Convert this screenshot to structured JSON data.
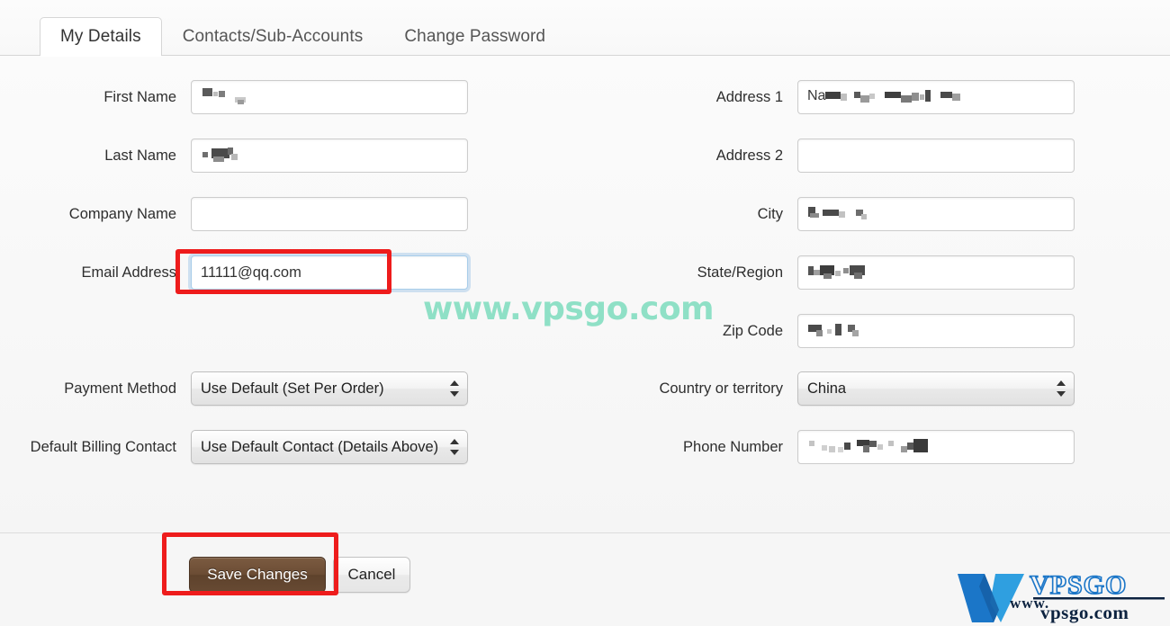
{
  "tabs": [
    {
      "label": "My Details",
      "active": true
    },
    {
      "label": "Contacts/Sub-Accounts",
      "active": false
    },
    {
      "label": "Change Password",
      "active": false
    }
  ],
  "form": {
    "left": [
      {
        "label": "First Name",
        "type": "text-redacted",
        "value": ""
      },
      {
        "label": "Last Name",
        "type": "text-redacted",
        "value": ""
      },
      {
        "label": "Company Name",
        "type": "text",
        "value": ""
      },
      {
        "label": "Email Address",
        "type": "text-focused",
        "value": "11111@qq.com"
      },
      {
        "label": "Payment Method",
        "type": "select",
        "value": "Use Default (Set Per Order)"
      },
      {
        "label": "Default Billing Contact",
        "type": "select",
        "value": "Use Default Contact (Details Above)"
      }
    ],
    "right": [
      {
        "label": "Address 1",
        "type": "text-redacted",
        "value": "Na"
      },
      {
        "label": "Address 2",
        "type": "text",
        "value": ""
      },
      {
        "label": "City",
        "type": "text-redacted",
        "value": ""
      },
      {
        "label": "State/Region",
        "type": "text-redacted",
        "value": ""
      },
      {
        "label": "Zip Code",
        "type": "text-redacted",
        "value": ""
      },
      {
        "label": "Country or territory",
        "type": "select",
        "value": "China"
      },
      {
        "label": "Phone Number",
        "type": "text-redacted",
        "value": ""
      }
    ]
  },
  "footer": {
    "save_label": "Save Changes",
    "cancel_label": "Cancel"
  },
  "annotations": {
    "color": "#ee1c1c",
    "targets": [
      "email-address-field",
      "save-changes-button"
    ]
  },
  "watermark": {
    "text": "www.vpsgo.com",
    "color": "#8fe0c6"
  },
  "logo": {
    "mark": "V",
    "brand": "VPSGO",
    "sub_www": "www.",
    "sub_domain": "vpsgo.com",
    "blue": "#1b76c8",
    "navy": "#0d2340"
  }
}
